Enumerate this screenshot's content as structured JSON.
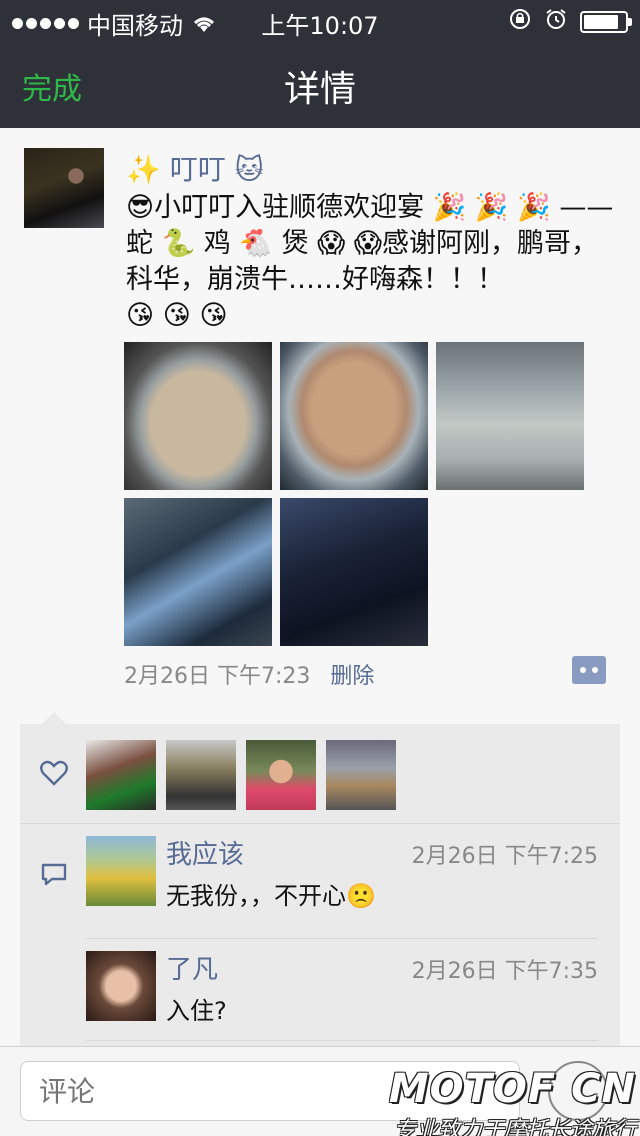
{
  "status_bar": {
    "carrier": "中国移动",
    "time": "上午10:07",
    "battery_level": 0.85
  },
  "nav": {
    "done_label": "完成",
    "title": "详情"
  },
  "post": {
    "username": "✨ 叮叮 🐱",
    "text": "😎小叮叮入驻顺德欢迎宴 🎉 🎉 🎉 ——蛇 🐍 鸡 🐔 煲 😱 😱感谢阿刚，鹏哥，科华，崩溃牛……好嗨森！！！\n😘 😘 😘",
    "date": "2月26日 下午7:23",
    "delete_label": "删除",
    "photo_count": 5
  },
  "likes": {
    "count": 4
  },
  "comments": [
    {
      "name": "我应该",
      "time": "2月26日 下午7:25",
      "text": "无我份，，不开心🙁"
    },
    {
      "name": "了凡",
      "time": "2月26日 下午7:35",
      "text": "入住?"
    }
  ],
  "comment_bar": {
    "placeholder": "评论"
  },
  "watermark": {
    "logo": "MOTOF CN",
    "tagline": "专业致力于摩托长途旅行"
  },
  "colors": {
    "accent_green": "#2fb84a",
    "link_blue": "#576b95",
    "bar_dark": "#2e3238"
  }
}
